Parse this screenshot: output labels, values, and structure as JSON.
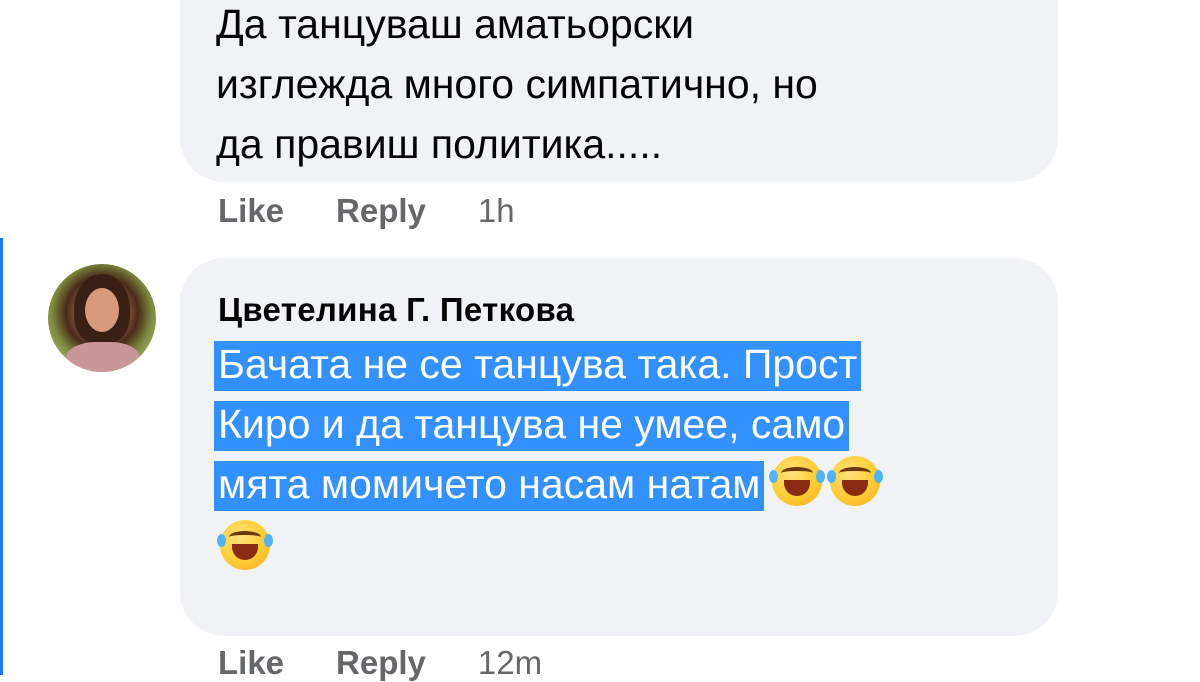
{
  "comment1": {
    "lines": [
      "Да танцуваш аматьорски",
      "изглежда много симпатично, но",
      "да правиш политика....."
    ],
    "actions": {
      "like": "Like",
      "reply": "Reply",
      "time": "1h"
    }
  },
  "comment2": {
    "author": "Цветелина Г. Петкова",
    "lines": [
      "Бачата не се танцува така. Прост",
      "Киро и да танцува не умее, само",
      "мята момичето насам натам"
    ],
    "emoji": "rolling-on-floor-laughing",
    "emoji_count": 3,
    "actions": {
      "like": "Like",
      "reply": "Reply",
      "time": "12m"
    }
  },
  "colors": {
    "bubble": "#f0f2f5",
    "selection": "#3390ff",
    "thread_line": "#1877f2",
    "meta": "#65676b"
  }
}
